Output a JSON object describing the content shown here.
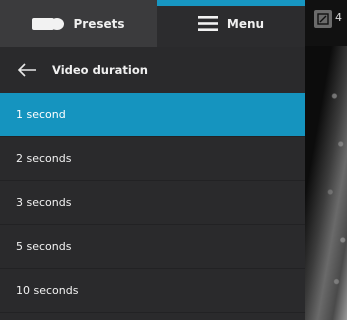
{
  "tabs": {
    "presets_label": "Presets",
    "menu_label": "Menu",
    "active": "menu",
    "accent_color": "#1796c2"
  },
  "submenu": {
    "title": "Video duration",
    "back_icon": "arrow-left-icon"
  },
  "durations": {
    "selected_index": 0,
    "items": [
      {
        "label": "1 second"
      },
      {
        "label": "2 seconds"
      },
      {
        "label": "3 seconds"
      },
      {
        "label": "5 seconds"
      },
      {
        "label": "10 seconds"
      }
    ]
  },
  "image_toolbar": {
    "tool_icon": "caliper-icon",
    "value": "4"
  }
}
